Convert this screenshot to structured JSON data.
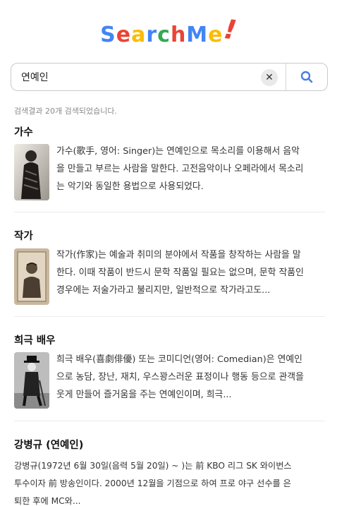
{
  "logo": {
    "letters": [
      {
        "ch": "S",
        "color": "#4285F4"
      },
      {
        "ch": "e",
        "color": "#EA4335"
      },
      {
        "ch": "a",
        "color": "#FBBC05"
      },
      {
        "ch": "r",
        "color": "#4285F4"
      },
      {
        "ch": "c",
        "color": "#34A853"
      },
      {
        "ch": "h",
        "color": "#EA4335"
      },
      {
        "ch": "M",
        "color": "#4285F4"
      },
      {
        "ch": "e",
        "color": "#FBBC05"
      },
      {
        "ch": "!",
        "color": "#EA4335"
      }
    ]
  },
  "search": {
    "value": "연예인",
    "placeholder": "",
    "clear_label": "✕"
  },
  "result_count": "검색결과 20개 검색되었습니다.",
  "results": [
    {
      "title": "가수",
      "lines": [
        "가수(歌手, 영어: Singer)는 연예인으로 목소리를 이용해서 음악",
        "을 만들고 부르는 사람을 말한다. 고전음악이나 오페라에서 목소리",
        "는 악기와 동일한 용법으로 사용되었다."
      ]
    },
    {
      "title": "작가",
      "lines": [
        "작가(作家)는 예술과 취미의 분야에서 작품을 창작하는 사람을 말",
        "한다. 이때 작품이 반드시 문학 작품일 필요는 없으며, 문학 작품인",
        "경우에는 저술가라고 불리지만, 일반적으로 작가라고도..."
      ]
    },
    {
      "title": "희극 배우",
      "lines": [
        "희극 배우(喜劇俳優) 또는 코미디언(영어: Comedian)은 연예인",
        "으로 농담, 장난, 재치, 우스꽝스러운 표정이나 행동 등으로 관객을",
        "웃게 만들어 즐거움을 주는 연예인이며, 희극..."
      ]
    },
    {
      "title": "강병규 (연예인)",
      "lines": [
        "강병규(1972년 6월 30일(음력 5월 20일) ~ )는 前 KBO 리그 SK 와이번스",
        "투수이자 前 방송인이다. 2000년 12월을 기점으로 하여 프로 야구 선수를 은",
        "퇴한 후에 MC와..."
      ]
    }
  ]
}
